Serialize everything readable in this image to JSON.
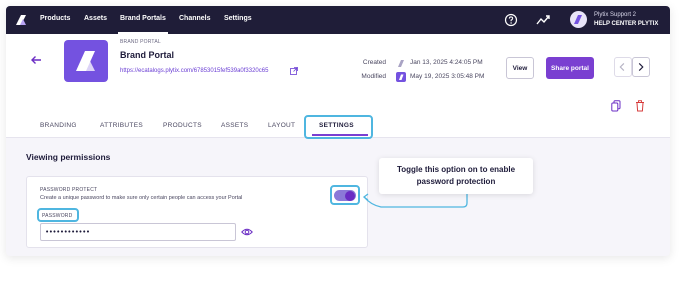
{
  "nav": {
    "items": [
      {
        "label": "Products",
        "active": false
      },
      {
        "label": "Assets",
        "active": false
      },
      {
        "label": "Brand Portals",
        "active": true
      },
      {
        "label": "Channels",
        "active": false
      },
      {
        "label": "Settings",
        "active": false
      }
    ],
    "icons": [
      "help-circle-icon",
      "activity-icon"
    ],
    "user_name": "Plytix Support 2",
    "user_org": "HELP CENTER PLYTIX"
  },
  "portal": {
    "caption": "BRAND PORTAL",
    "title": "Brand Portal",
    "url": "https://ecatalogs.plytix.com/67853015fef539a0f3320c65"
  },
  "meta": {
    "created_label": "Created",
    "created_value": "Jan 13, 2025 4:24:05 PM",
    "modified_label": "Modified",
    "modified_value": "May 19, 2025 3:05:48 PM"
  },
  "actions": {
    "view_label": "View",
    "share_label": "Share portal",
    "prev_icon": "chevron-left-icon",
    "next_icon": "chevron-right-icon",
    "duplicate_icon": "duplicate-icon",
    "delete_icon": "trash-icon"
  },
  "tabs": [
    {
      "label": "BRANDING",
      "active": false
    },
    {
      "label": "ATTRIBUTES",
      "active": false
    },
    {
      "label": "PRODUCTS",
      "active": false
    },
    {
      "label": "ASSETS",
      "active": false
    },
    {
      "label": "LAYOUT",
      "active": false
    },
    {
      "label": "SETTINGS",
      "active": true
    }
  ],
  "permissions": {
    "section_title": "Viewing permissions",
    "password_protect_label": "PASSWORD PROTECT",
    "password_protect_desc": "Create a unique password to make sure only certain people can access your Portal",
    "password_label": "PASSWORD",
    "password_value": "••••••••••••",
    "toggle_on": true
  },
  "tooltip": {
    "text": "Toggle this option on to enable\npassword protection"
  },
  "colors": {
    "nav_bg": "#1f1d38",
    "accent": "#7a3fd1",
    "callout": "#4fb6e0",
    "logo": "#7452e0"
  }
}
